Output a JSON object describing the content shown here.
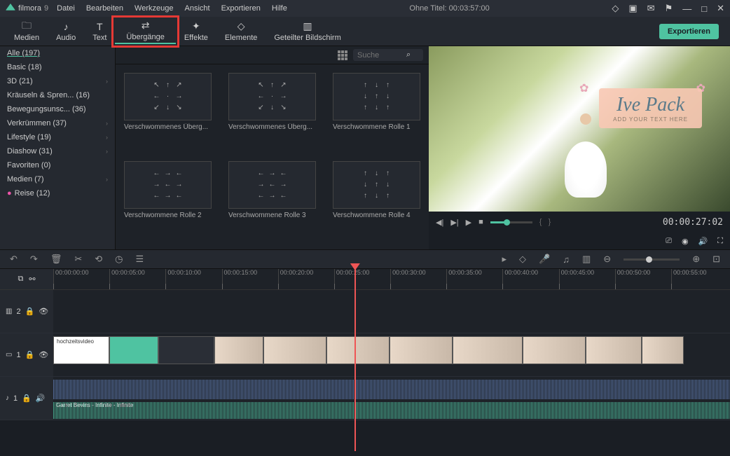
{
  "app": {
    "name": "filmora",
    "version": "9"
  },
  "menu": [
    "Datei",
    "Bearbeiten",
    "Werkzeuge",
    "Ansicht",
    "Exportieren",
    "Hilfe"
  ],
  "title": "Ohne Titel:  00:03:57:00",
  "tools": [
    {
      "label": "Medien",
      "icon": "folder"
    },
    {
      "label": "Audio",
      "icon": "music"
    },
    {
      "label": "Text",
      "icon": "text"
    },
    {
      "label": "Übergänge",
      "icon": "transition",
      "active": true,
      "highlight": true
    },
    {
      "label": "Effekte",
      "icon": "sparkle"
    },
    {
      "label": "Elemente",
      "icon": "elements"
    },
    {
      "label": "Geteilter Bildschirm",
      "icon": "split"
    }
  ],
  "export_btn": "Exportieren",
  "sidebar": [
    {
      "label": "Alle (197)",
      "sel": true
    },
    {
      "label": "Basic (18)"
    },
    {
      "label": "3D (21)",
      "sub": true
    },
    {
      "label": "Kräuseln & Spren... (16)"
    },
    {
      "label": "Bewegungsunsc... (36)"
    },
    {
      "label": "Verkrümmen (37)",
      "sub": true
    },
    {
      "label": "Lifestyle (19)",
      "sub": true
    },
    {
      "label": "Diashow (31)",
      "sub": true
    },
    {
      "label": "Favoriten (0)"
    },
    {
      "label": "Medien (7)",
      "sub": true
    },
    {
      "label": "Reise (12)",
      "dot": true
    }
  ],
  "search_placeholder": "Suche",
  "thumbs": [
    "Verschwommenes Überg...",
    "Verschwommenes Überg...",
    "Verschwommene Rolle 1",
    "Verschwommene Rolle 2",
    "Verschwommene Rolle 3",
    "Verschwommene Rolle 4"
  ],
  "preview": {
    "title": "Ive Pack",
    "subtitle": "ADD YOUR TEXT HERE",
    "time": "00:00:27:02"
  },
  "timeline": {
    "ticks": [
      "00:00:00:00",
      "00:00:05:00",
      "00:00:10:00",
      "00:00:15:00",
      "00:00:20:00",
      "00:00:25:00",
      "00:00:30:00",
      "00:00:35:00",
      "00:00:40:00",
      "00:00:45:00",
      "00:00:50:00",
      "00:00:55:00"
    ],
    "playhead_pct": 44.5,
    "tracks": {
      "fx": {
        "label": "2",
        "icons": [
          "lock",
          "eye"
        ]
      },
      "video": {
        "label": "1",
        "icons": [
          "lock",
          "eye"
        ],
        "clip_label": "hochzeitsvideo"
      },
      "audio": {
        "label": "1",
        "icons": [
          "lock",
          "speaker"
        ],
        "wave_label": "Garret Bevins - Infinite - Infinite"
      }
    }
  }
}
